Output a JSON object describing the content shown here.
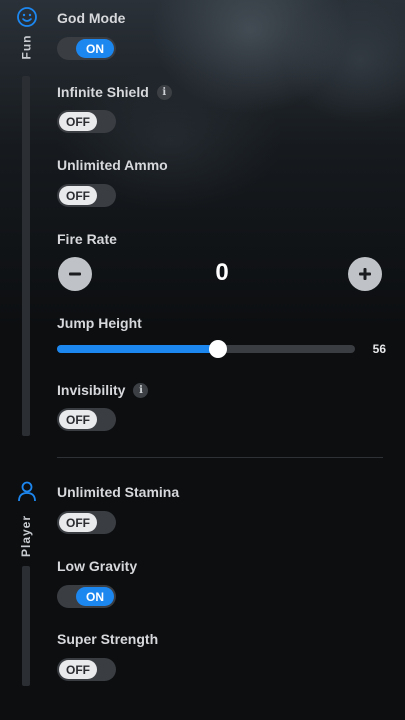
{
  "sidebar": {
    "sections": [
      {
        "label": "Fun",
        "icon": "smiley-icon"
      },
      {
        "label": "Player",
        "icon": "person-icon"
      }
    ]
  },
  "fun": {
    "god_mode": {
      "label": "God Mode",
      "state": "ON"
    },
    "infinite_shield": {
      "label": "Infinite Shield",
      "state": "OFF",
      "info": "i"
    },
    "unlimited_ammo": {
      "label": "Unlimited Ammo",
      "state": "OFF"
    },
    "fire_rate": {
      "label": "Fire Rate",
      "value": "0",
      "minus_icon": "minus-icon",
      "plus_icon": "plus-icon"
    },
    "jump_height": {
      "label": "Jump Height",
      "value": "56",
      "fraction": 0.54
    },
    "invisibility": {
      "label": "Invisibility",
      "state": "OFF",
      "info": "i"
    }
  },
  "player": {
    "unlimited_stamina": {
      "label": "Unlimited Stamina",
      "state": "OFF"
    },
    "low_gravity": {
      "label": "Low Gravity",
      "state": "ON"
    },
    "super_strength": {
      "label": "Super Strength",
      "state": "OFF"
    }
  },
  "colors": {
    "accent": "#1d87f0",
    "toggle_off_pill": "#e9eaec",
    "track": "#3a3d42",
    "background": "#0c0e10"
  }
}
